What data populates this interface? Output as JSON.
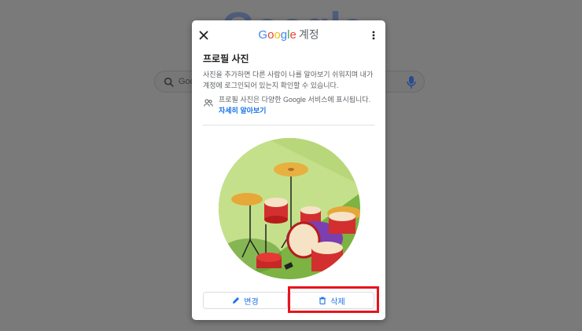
{
  "background": {
    "logo_text": "Google",
    "search_placeholder": "Goo"
  },
  "dialog": {
    "brand": {
      "letters": [
        "G",
        "o",
        "o",
        "g",
        "l",
        "e"
      ],
      "colors": [
        "#4285f4",
        "#ea4335",
        "#fbbc05",
        "#4285f4",
        "#34a853",
        "#ea4335"
      ]
    },
    "title_suffix": "계정",
    "heading": "프로필 사진",
    "description": "사진을 추가하면 다른 사람이 나를 알아보기 쉬워지며 내가 계정에 로그인되어 있는지 확인할 수 있습니다.",
    "info_text": "프로필 사진은 다양한 Google 서비스에 표시됩니다.",
    "info_link": "자세히 알아보기",
    "buttons": {
      "change": "변경",
      "delete": "삭제"
    },
    "accent_color": "#1a73e8",
    "highlight_color": "#e8141b"
  },
  "icons": {
    "close": "close-icon",
    "more": "more-vert-icon",
    "people": "people-icon",
    "pencil": "pencil-icon",
    "trash": "trash-icon",
    "search": "search-icon",
    "mic": "mic-icon"
  }
}
